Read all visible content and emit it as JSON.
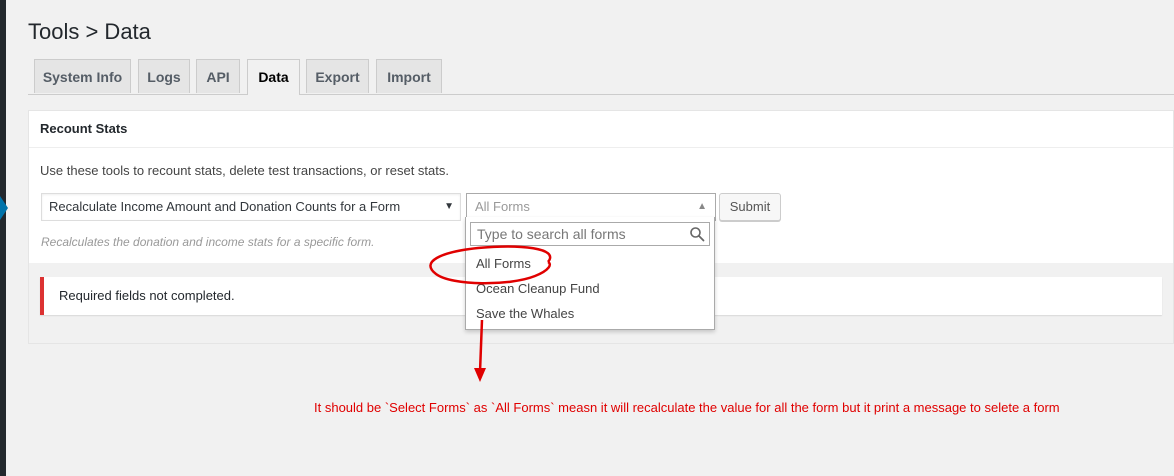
{
  "page": {
    "title": "Tools > Data"
  },
  "tabs": [
    {
      "label": "System Info",
      "active": false
    },
    {
      "label": "Logs",
      "active": false
    },
    {
      "label": "API",
      "active": false
    },
    {
      "label": "Data",
      "active": true
    },
    {
      "label": "Export",
      "active": false
    },
    {
      "label": "Import",
      "active": false
    }
  ],
  "recount": {
    "title": "Recount Stats",
    "description": "Use these tools to recount stats, delete test transactions, or reset stats.",
    "tool_select": {
      "value": "Recalculate Income Amount and Donation Counts for a Form",
      "caret": "▼"
    },
    "forms_select": {
      "value": "All Forms",
      "caret": "▲"
    },
    "submit_label": "Submit",
    "hint": "Recalculates the donation and income stats for a specific form.",
    "notice": "Required fields not completed."
  },
  "dropdown": {
    "search_placeholder": "Type to search all forms",
    "search_icon": "search-icon",
    "options": [
      "All Forms",
      "Ocean Cleanup Fund",
      "Save the Whales"
    ]
  },
  "annotation": {
    "text": "It should be `Select Forms` as `All Forms` measn it will recalculate the value for all the form but it print a message to selete a form",
    "color": "#e00000"
  },
  "colors": {
    "notice_border": "#dc3232",
    "background": "#f1f1f1"
  }
}
